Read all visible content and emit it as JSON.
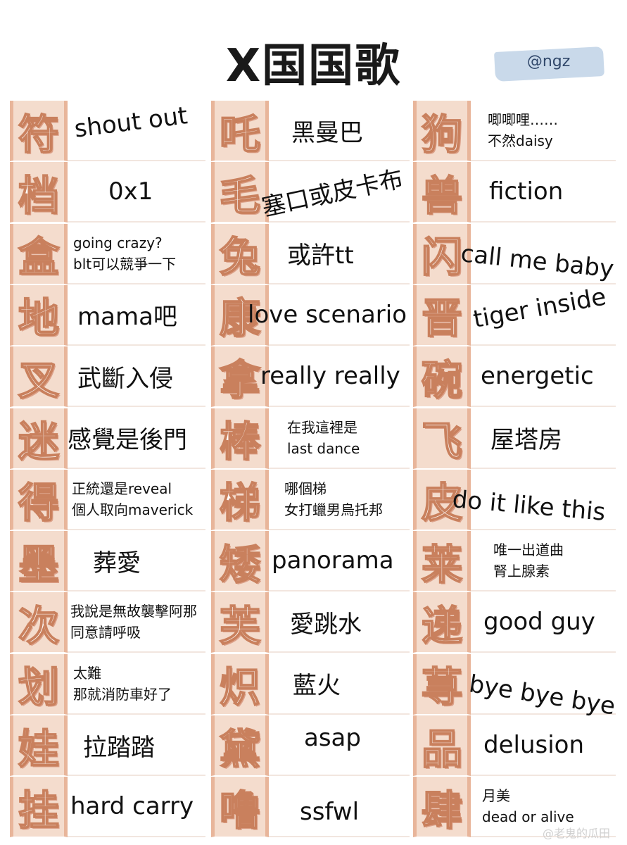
{
  "title": "X国国歌",
  "tag": "@ngz",
  "watermark": "@老鬼的瓜田",
  "columns": [
    {
      "rows": [
        {
          "char": "符",
          "lines": [
            "shout out"
          ]
        },
        {
          "char": "档",
          "lines": [
            "0x1"
          ]
        },
        {
          "char": "盒",
          "lines": [
            "going crazy?",
            "blt可以競爭一下"
          ]
        },
        {
          "char": "地",
          "lines": [
            "mama吧"
          ]
        },
        {
          "char": "叉",
          "lines": [
            "武斷入侵"
          ]
        },
        {
          "char": "迷",
          "lines": [
            "感覺是後門"
          ]
        },
        {
          "char": "得",
          "lines": [
            "正統還是reveal",
            "個人取向maverick"
          ]
        },
        {
          "char": "墨",
          "lines": [
            "葬愛"
          ]
        },
        {
          "char": "次",
          "lines": [
            "我說是無故襲擊阿那",
            "同意請呼吸"
          ]
        },
        {
          "char": "划",
          "lines": [
            "太難",
            "那就消防車好了"
          ]
        },
        {
          "char": "娃",
          "lines": [
            "拉踏踏"
          ]
        },
        {
          "char": "挂",
          "lines": [
            "hard carry"
          ]
        }
      ]
    },
    {
      "rows": [
        {
          "char": "吒",
          "lines": [
            "黑曼巴"
          ]
        },
        {
          "char": "毛",
          "lines": [
            "塞口或皮卡布"
          ]
        },
        {
          "char": "兔",
          "lines": [
            "或許tt"
          ]
        },
        {
          "char": "康",
          "lines": [
            "love scenario"
          ]
        },
        {
          "char": "拿",
          "lines": [
            "really really"
          ]
        },
        {
          "char": "棒",
          "lines": [
            "在我這裡是",
            "last dance"
          ]
        },
        {
          "char": "梯",
          "lines": [
            "哪個梯",
            "女打蠟男烏托邦"
          ]
        },
        {
          "char": "矮",
          "lines": [
            "panorama"
          ]
        },
        {
          "char": "芙",
          "lines": [
            "愛跳水"
          ]
        },
        {
          "char": "炽",
          "lines": [
            "藍火"
          ]
        },
        {
          "char": "黛",
          "lines": [
            "asap"
          ]
        },
        {
          "char": "噜",
          "lines": [
            "ssfwl"
          ]
        }
      ]
    },
    {
      "rows": [
        {
          "char": "狗",
          "lines": [
            "唧唧哩……",
            "不然daisy"
          ]
        },
        {
          "char": "兽",
          "lines": [
            "fiction"
          ]
        },
        {
          "char": "闪",
          "lines": [
            "call me baby"
          ]
        },
        {
          "char": "晋",
          "lines": [
            "tiger inside"
          ]
        },
        {
          "char": "碗",
          "lines": [
            "energetic"
          ]
        },
        {
          "char": "飞",
          "lines": [
            "屋塔房"
          ]
        },
        {
          "char": "皮",
          "lines": [
            "do it like this"
          ]
        },
        {
          "char": "莱",
          "lines": [
            "唯一出道曲",
            "腎上腺素"
          ]
        },
        {
          "char": "递",
          "lines": [
            "good guy"
          ]
        },
        {
          "char": "荨",
          "lines": [
            "bye bye bye"
          ]
        },
        {
          "char": "品",
          "lines": [
            "delusion"
          ]
        },
        {
          "char": "肆",
          "lines": [
            "月美",
            "dead or alive"
          ]
        }
      ]
    }
  ]
}
